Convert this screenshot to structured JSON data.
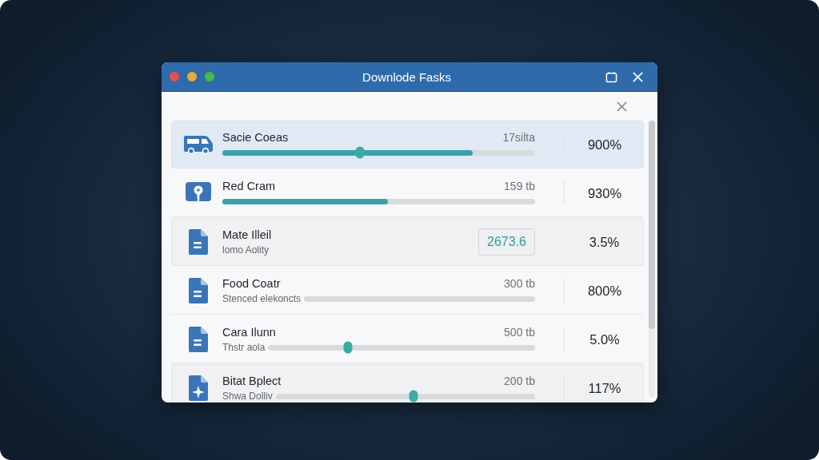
{
  "window": {
    "title": "Downlode Fasks"
  },
  "rows": [
    {
      "kind": "progress",
      "name": "Sacie Coeas",
      "size": "17silta",
      "level": 0.8,
      "thumb": {
        "level": 0.44
      },
      "percent": "900%",
      "selected": true,
      "highlighted": false
    },
    {
      "kind": "progress",
      "name": "Red Cram",
      "size": "159 tb",
      "level": 0.53,
      "percent": "930%",
      "selected": false,
      "highlighted": false
    },
    {
      "kind": "value",
      "name": "Mate Illeil",
      "subtitle": "lomo Aolity",
      "value": "2673.6",
      "percent": "3.5%",
      "selected": false,
      "highlighted": true
    },
    {
      "kind": "progress",
      "name": "Food Coatr",
      "subtitle": "Stenced elekoncts",
      "size": "300 tb",
      "percent": "800%",
      "selected": false,
      "highlighted": false
    },
    {
      "kind": "progress",
      "name": "Cara Ilunn",
      "subtitle": "Thstr aola",
      "size": "500 tb",
      "thumb": {
        "level": 0.3
      },
      "percent": "5.0%",
      "selected": false,
      "highlighted": false
    },
    {
      "kind": "progress",
      "name": "Bitat Bplect",
      "subtitle": "Shwa Dolliv",
      "size": "200 tb",
      "thumb": {
        "level": 0.53
      },
      "percent": "117%",
      "selected": false,
      "highlighted": true
    }
  ]
}
